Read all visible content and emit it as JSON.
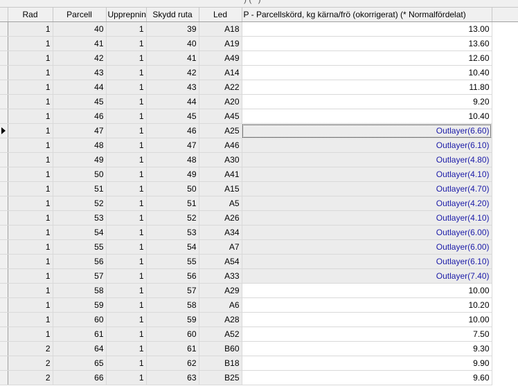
{
  "header_cutoff_text": "          )    (**)",
  "columns": [
    {
      "label": "Rad"
    },
    {
      "label": "Parcell"
    },
    {
      "label": "Upprepning"
    },
    {
      "label": "Skydd ruta"
    },
    {
      "label": "Led"
    },
    {
      "label": "P - Parcellskörd, kg kärna/frö (okorrigerat) (* Normalfördelat)"
    }
  ],
  "current_row_index": 7,
  "rows": [
    {
      "rad": "1",
      "parcell": "40",
      "upp": "1",
      "skydd": "39",
      "led": "A18",
      "value": "13.00",
      "outlier": false
    },
    {
      "rad": "1",
      "parcell": "41",
      "upp": "1",
      "skydd": "40",
      "led": "A19",
      "value": "13.60",
      "outlier": false
    },
    {
      "rad": "1",
      "parcell": "42",
      "upp": "1",
      "skydd": "41",
      "led": "A49",
      "value": "12.60",
      "outlier": false
    },
    {
      "rad": "1",
      "parcell": "43",
      "upp": "1",
      "skydd": "42",
      "led": "A14",
      "value": "10.40",
      "outlier": false
    },
    {
      "rad": "1",
      "parcell": "44",
      "upp": "1",
      "skydd": "43",
      "led": "A22",
      "value": "11.80",
      "outlier": false
    },
    {
      "rad": "1",
      "parcell": "45",
      "upp": "1",
      "skydd": "44",
      "led": "A20",
      "value": "9.20",
      "outlier": false
    },
    {
      "rad": "1",
      "parcell": "46",
      "upp": "1",
      "skydd": "45",
      "led": "A45",
      "value": "10.40",
      "outlier": false
    },
    {
      "rad": "1",
      "parcell": "47",
      "upp": "1",
      "skydd": "46",
      "led": "A25",
      "value": "Outlayer(6.60)",
      "outlier": true
    },
    {
      "rad": "1",
      "parcell": "48",
      "upp": "1",
      "skydd": "47",
      "led": "A46",
      "value": "Outlayer(6.10)",
      "outlier": true
    },
    {
      "rad": "1",
      "parcell": "49",
      "upp": "1",
      "skydd": "48",
      "led": "A30",
      "value": "Outlayer(4.80)",
      "outlier": true
    },
    {
      "rad": "1",
      "parcell": "50",
      "upp": "1",
      "skydd": "49",
      "led": "A41",
      "value": "Outlayer(4.10)",
      "outlier": true
    },
    {
      "rad": "1",
      "parcell": "51",
      "upp": "1",
      "skydd": "50",
      "led": "A15",
      "value": "Outlayer(4.70)",
      "outlier": true
    },
    {
      "rad": "1",
      "parcell": "52",
      "upp": "1",
      "skydd": "51",
      "led": "A5",
      "value": "Outlayer(4.20)",
      "outlier": true
    },
    {
      "rad": "1",
      "parcell": "53",
      "upp": "1",
      "skydd": "52",
      "led": "A26",
      "value": "Outlayer(4.10)",
      "outlier": true
    },
    {
      "rad": "1",
      "parcell": "54",
      "upp": "1",
      "skydd": "53",
      "led": "A34",
      "value": "Outlayer(6.00)",
      "outlier": true
    },
    {
      "rad": "1",
      "parcell": "55",
      "upp": "1",
      "skydd": "54",
      "led": "A7",
      "value": "Outlayer(6.00)",
      "outlier": true
    },
    {
      "rad": "1",
      "parcell": "56",
      "upp": "1",
      "skydd": "55",
      "led": "A54",
      "value": "Outlayer(6.10)",
      "outlier": true
    },
    {
      "rad": "1",
      "parcell": "57",
      "upp": "1",
      "skydd": "56",
      "led": "A33",
      "value": "Outlayer(7.40)",
      "outlier": true
    },
    {
      "rad": "1",
      "parcell": "58",
      "upp": "1",
      "skydd": "57",
      "led": "A29",
      "value": "10.00",
      "outlier": false
    },
    {
      "rad": "1",
      "parcell": "59",
      "upp": "1",
      "skydd": "58",
      "led": "A6",
      "value": "10.20",
      "outlier": false
    },
    {
      "rad": "1",
      "parcell": "60",
      "upp": "1",
      "skydd": "59",
      "led": "A28",
      "value": "10.00",
      "outlier": false
    },
    {
      "rad": "1",
      "parcell": "61",
      "upp": "1",
      "skydd": "60",
      "led": "A52",
      "value": "7.50",
      "outlier": false
    },
    {
      "rad": "2",
      "parcell": "64",
      "upp": "1",
      "skydd": "61",
      "led": "B60",
      "value": "9.30",
      "outlier": false
    },
    {
      "rad": "2",
      "parcell": "65",
      "upp": "1",
      "skydd": "62",
      "led": "B18",
      "value": "9.90",
      "outlier": false
    },
    {
      "rad": "2",
      "parcell": "66",
      "upp": "1",
      "skydd": "63",
      "led": "B25",
      "value": "9.60",
      "outlier": false
    }
  ],
  "colors": {
    "header_bg": "#f0f0f0",
    "readonly_cell_bg": "#ececec",
    "outlier_text": "#1c1ca8"
  }
}
